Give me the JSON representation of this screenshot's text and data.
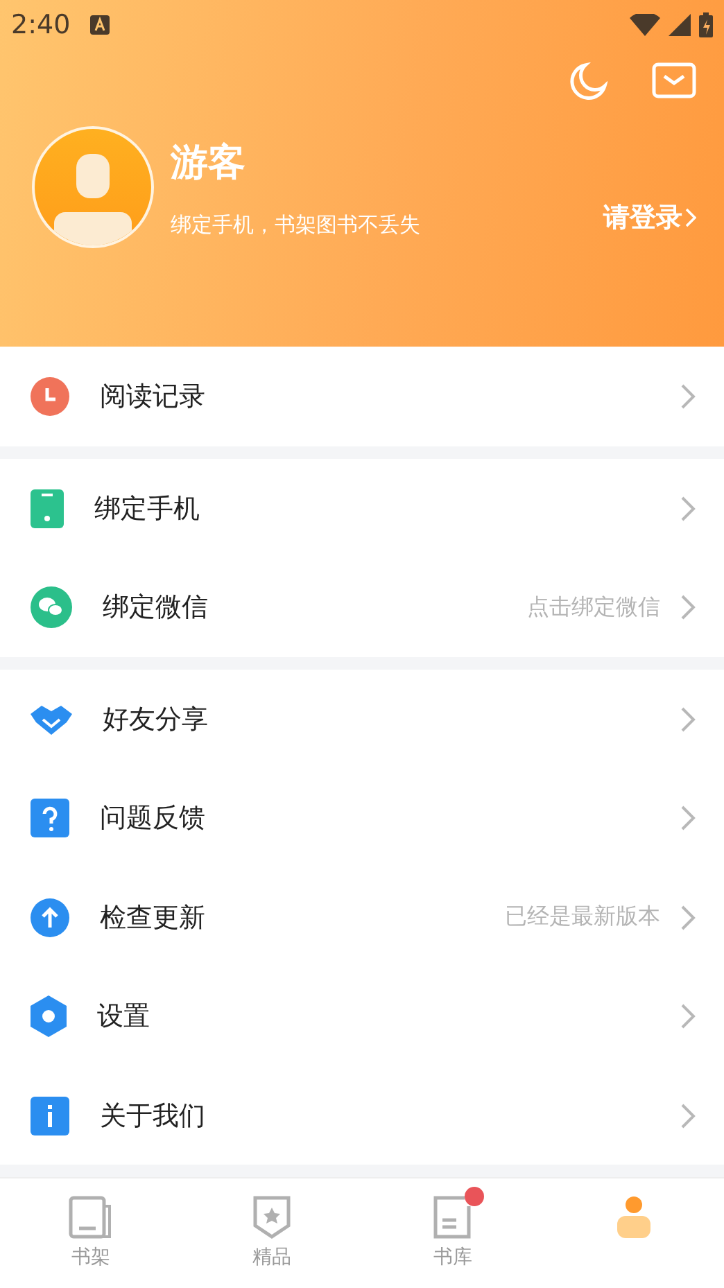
{
  "status_bar": {
    "time": "2:40"
  },
  "profile": {
    "name": "游客",
    "subtitle": "绑定手机，书架图书不丢失",
    "login": "请登录"
  },
  "sections": [
    {
      "items": [
        {
          "label": "阅读记录"
        }
      ]
    },
    {
      "items": [
        {
          "label": "绑定手机"
        },
        {
          "label": "绑定微信",
          "hint": "点击绑定微信"
        }
      ]
    },
    {
      "items": [
        {
          "label": "好友分享"
        },
        {
          "label": "问题反馈"
        },
        {
          "label": "检查更新",
          "hint": "已经是最新版本"
        },
        {
          "label": "设置"
        },
        {
          "label": "关于我们"
        }
      ]
    }
  ],
  "tabs": [
    {
      "label": "书架",
      "selected": false,
      "badge": false
    },
    {
      "label": "精品",
      "selected": false,
      "badge": false
    },
    {
      "label": "书库",
      "selected": false,
      "badge": true
    },
    {
      "selected": true,
      "badge": false
    }
  ]
}
